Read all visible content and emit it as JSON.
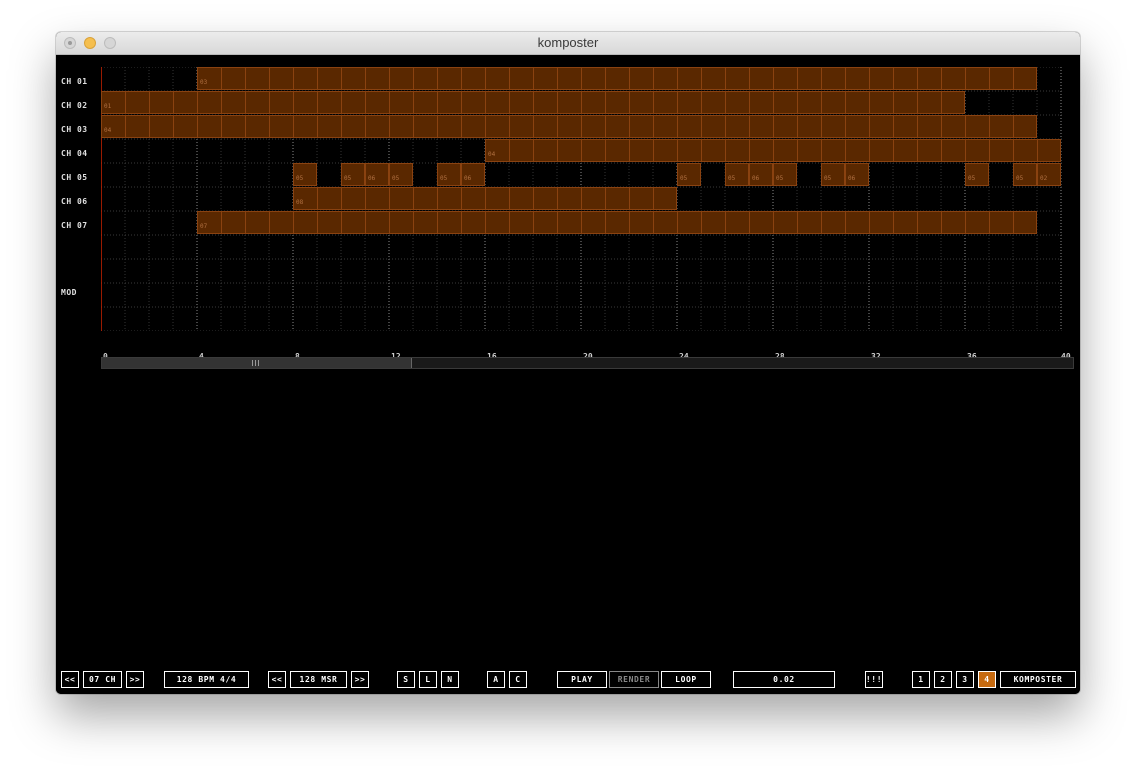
{
  "window": {
    "title": "komposter"
  },
  "channels": [
    "CH 01",
    "CH 02",
    "CH 03",
    "CH 04",
    "CH 05",
    "CH 06",
    "CH 07"
  ],
  "mod_label": "MOD",
  "ticks": [
    "0",
    "4",
    "8",
    "12",
    "16",
    "20",
    "24",
    "28",
    "32",
    "36",
    "40"
  ],
  "clips": [
    {
      "row": 0,
      "start": 4,
      "end": 39,
      "label": "03"
    },
    {
      "row": 1,
      "start": 0,
      "end": 36,
      "label": "01"
    },
    {
      "row": 2,
      "start": 0,
      "end": 39,
      "label": "04"
    },
    {
      "row": 3,
      "start": 16,
      "end": 40,
      "label": "04"
    },
    {
      "row": 4,
      "start": 8,
      "end": 9,
      "label": "05"
    },
    {
      "row": 4,
      "start": 10,
      "end": 11,
      "label": "05"
    },
    {
      "row": 4,
      "start": 11,
      "end": 12,
      "label": "06"
    },
    {
      "row": 4,
      "start": 12,
      "end": 13,
      "label": "05"
    },
    {
      "row": 4,
      "start": 14,
      "end": 15,
      "label": "05"
    },
    {
      "row": 4,
      "start": 15,
      "end": 16,
      "label": "06"
    },
    {
      "row": 4,
      "start": 24,
      "end": 25,
      "label": "05"
    },
    {
      "row": 4,
      "start": 26,
      "end": 27,
      "label": "05"
    },
    {
      "row": 4,
      "start": 27,
      "end": 28,
      "label": "06"
    },
    {
      "row": 4,
      "start": 28,
      "end": 29,
      "label": "05"
    },
    {
      "row": 4,
      "start": 30,
      "end": 31,
      "label": "05"
    },
    {
      "row": 4,
      "start": 31,
      "end": 32,
      "label": "06"
    },
    {
      "row": 4,
      "start": 36,
      "end": 37,
      "label": "05"
    },
    {
      "row": 4,
      "start": 38,
      "end": 39,
      "label": "05"
    },
    {
      "row": 4,
      "start": 39,
      "end": 40,
      "label": "02"
    },
    {
      "row": 5,
      "start": 8,
      "end": 24,
      "label": "08"
    },
    {
      "row": 6,
      "start": 4,
      "end": 39,
      "label": "07"
    }
  ],
  "toolbar": {
    "ch_prev": "<<",
    "channels": "07 CH",
    "ch_next": ">>",
    "tempo": "128 BPM 4/4",
    "msr_prev": "<<",
    "measures": "128 MSR",
    "msr_next": ">>",
    "s": "S",
    "l": "L",
    "n": "N",
    "a": "A",
    "c": "C",
    "play": "PLAY",
    "render": "RENDER",
    "loop": "LOOP",
    "time": "0.02",
    "bars": "!!!",
    "page1": "1",
    "page2": "2",
    "page3": "3",
    "page4": "4",
    "app": "KOMPOSTER"
  },
  "colors": {
    "clip_fill": "#5a2800",
    "clip_border": "#8a4210",
    "active_page": "#c66a10",
    "playhead": "#cc2200"
  }
}
